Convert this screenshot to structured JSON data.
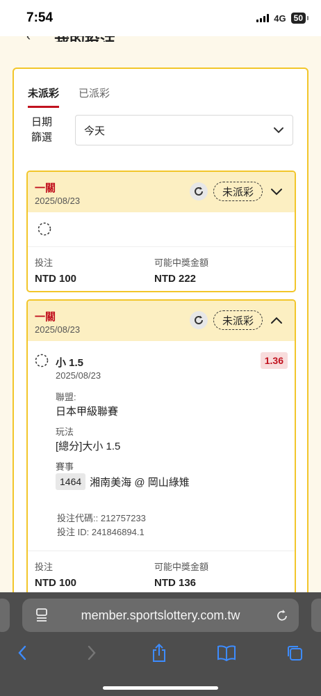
{
  "status_bar": {
    "time": "7:54",
    "network": "4G",
    "battery": "50"
  },
  "page": {
    "title": "我的投注"
  },
  "tabs": [
    {
      "label": "未派彩",
      "active": true
    },
    {
      "label": "已派彩",
      "active": false
    }
  ],
  "date_filter": {
    "label_line1": "日期",
    "label_line2": "篩選",
    "value": "今天"
  },
  "bets": [
    {
      "type": "一關",
      "date": "2025/08/23",
      "status": "未派彩",
      "expanded": false,
      "stake_label": "投注",
      "stake": "NTD 100",
      "payout_label": "可能中獎金額",
      "payout": "NTD 222"
    },
    {
      "type": "一關",
      "date": "2025/08/23",
      "status": "未派彩",
      "expanded": true,
      "selection": {
        "name": "小 1.5",
        "date": "2025/08/23",
        "odds": "1.36",
        "league_label": "聯盟:",
        "league": "日本甲級聯賽",
        "market_label": "玩法",
        "market": "[總分]大小 1.5",
        "event_label": "賽事",
        "event_code": "1464",
        "event_name": "湘南美海 @ 岡山綠雉",
        "bet_code": "投注代碼:: 212757233",
        "bet_id": "投注 ID: 241846894.1"
      },
      "stake_label": "投注",
      "stake": "NTD 100",
      "payout_label": "可能中獎金額",
      "payout": "NTD 136"
    }
  ],
  "browser": {
    "url": "member.sportslottery.com.tw"
  },
  "colors": {
    "accent_red": "#c1121f",
    "panel_border": "#f2c62a",
    "card_header": "#fcefc2"
  }
}
